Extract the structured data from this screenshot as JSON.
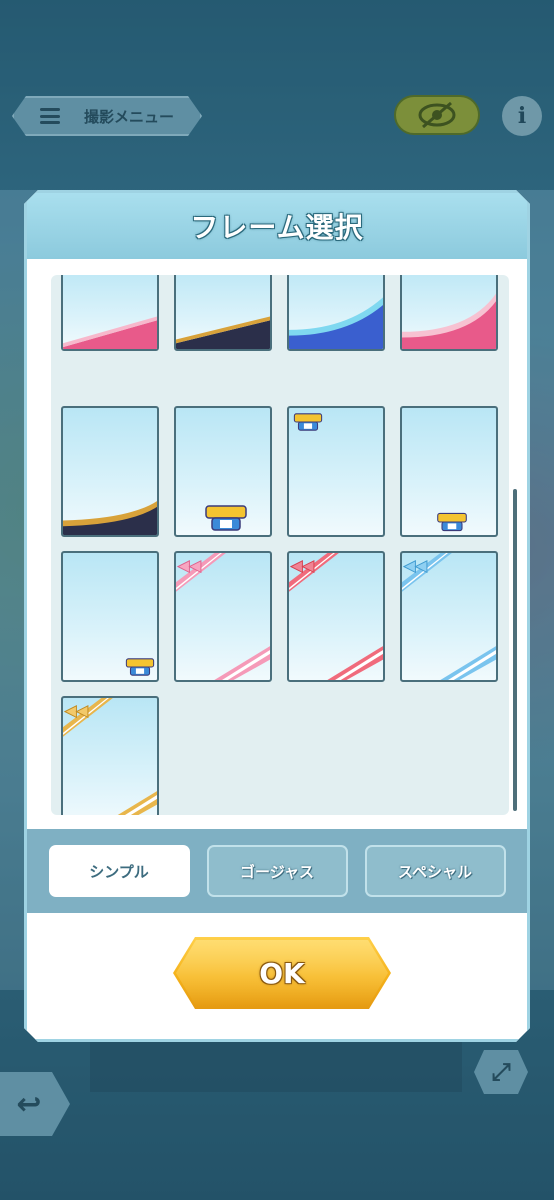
{
  "top_bar": {
    "menu_label": "撮影メニュー",
    "info_label": "i"
  },
  "modal": {
    "title": "フレーム選択",
    "tabs": [
      {
        "label": "シンプル",
        "active": true
      },
      {
        "label": "ゴージャス",
        "active": false
      },
      {
        "label": "スペシャル",
        "active": false
      }
    ],
    "ok_label": "OK"
  },
  "frames": [
    {
      "style": "pink-wave"
    },
    {
      "style": "gold-navy-wave"
    },
    {
      "style": "blue-wave"
    },
    {
      "style": "pink-curve"
    },
    {
      "style": "gold-navy-curve"
    },
    {
      "style": "logo-bottom-center"
    },
    {
      "style": "logo-top-left"
    },
    {
      "style": "logo-bottom-right"
    },
    {
      "style": "logo-bottom-right-small"
    },
    {
      "style": "pink-ribbon"
    },
    {
      "style": "red-ribbon"
    },
    {
      "style": "blue-ribbon"
    },
    {
      "style": "gold-ribbon"
    }
  ],
  "colors": {
    "accent_ok": "#f5b21a",
    "header": "#8ccadd",
    "tab_bar": "#7fb0c3"
  }
}
